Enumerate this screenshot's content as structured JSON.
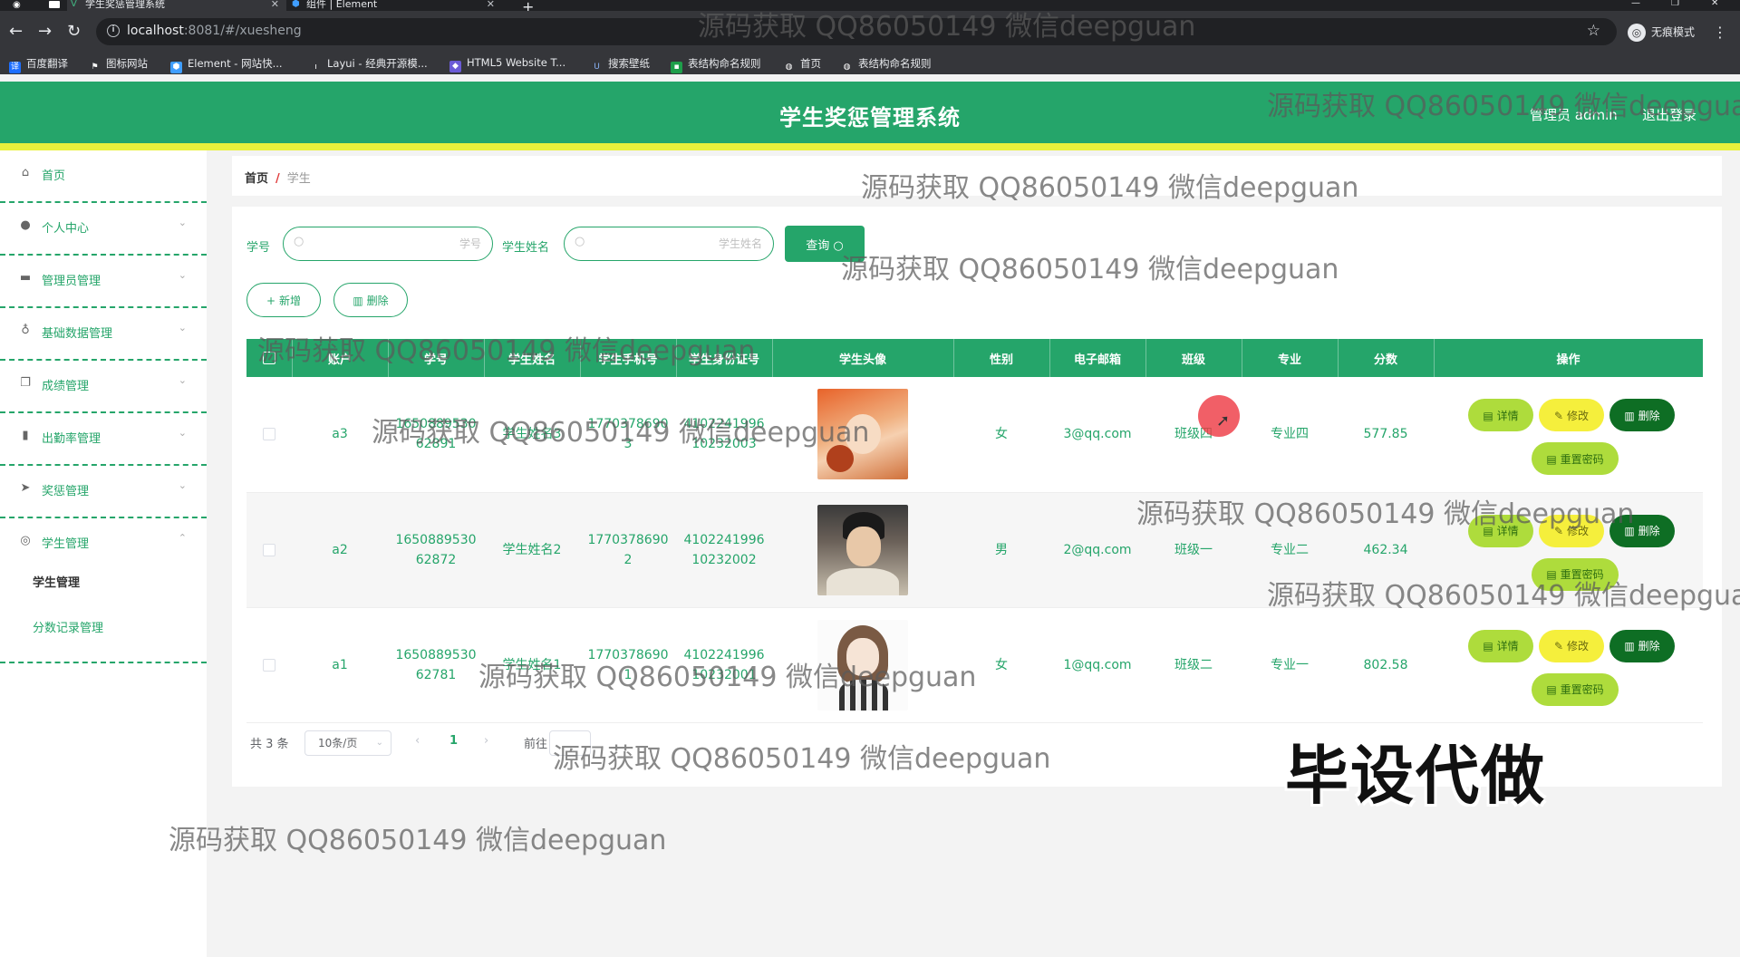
{
  "browser": {
    "tabs": [
      {
        "title": "学生奖惩管理系统",
        "active": true
      },
      {
        "title": "组件 | Element",
        "active": false
      }
    ],
    "url_host": "localhost",
    "url_rest": ":8081/#/xuesheng",
    "incognito_label": "无痕模式",
    "bookmarks": [
      "百度翻译",
      "图标网站",
      "Element - 网站快...",
      "Layui - 经典开源模...",
      "HTML5 Website T...",
      "搜索壁纸",
      "表结构命名规则",
      "首页",
      "表结构命名规则"
    ]
  },
  "header": {
    "title": "学生奖惩管理系统",
    "user": "管理员 admin",
    "logout": "退出登录",
    "colors": {
      "primary": "#25a56a",
      "stripe": "#eaf03c"
    }
  },
  "sidebar": {
    "items": [
      {
        "label": "首页",
        "icon": "home-icon"
      },
      {
        "label": "个人中心",
        "icon": "user-icon"
      },
      {
        "label": "管理员管理",
        "icon": "chat-icon"
      },
      {
        "label": "基础数据管理",
        "icon": "mic-icon"
      },
      {
        "label": "成绩管理",
        "icon": "copy-icon"
      },
      {
        "label": "出勤率管理",
        "icon": "bar-chart-icon"
      },
      {
        "label": "奖惩管理",
        "icon": "send-icon"
      },
      {
        "label": "学生管理",
        "icon": "compass-icon"
      }
    ],
    "sub_items": [
      {
        "label": "学生管理",
        "active": true
      },
      {
        "label": "分数记录管理",
        "active": false
      }
    ]
  },
  "breadcrumb": {
    "home": "首页",
    "separator": "/",
    "current": "学生"
  },
  "search": {
    "student_no_label": "学号",
    "student_no_placeholder": "学号",
    "student_name_label": "学生姓名",
    "student_name_placeholder": "学生姓名",
    "query_button": "查询"
  },
  "actions": {
    "add": "新增",
    "delete": "删除"
  },
  "table": {
    "columns": [
      "账户",
      "学号",
      "学生姓名",
      "学生手机号",
      "学生身份证号",
      "学生头像",
      "性别",
      "电子邮箱",
      "班级",
      "专业",
      "分数",
      "操作"
    ],
    "rows": [
      {
        "account": "a3",
        "student_no": "165088953062891",
        "student_no_l1": "1650889530",
        "student_no_l2": "62891",
        "name": "学生姓名3",
        "phone_l1": "1770378690",
        "phone_l2": "3",
        "id_l1": "4102241996",
        "id_l2": "10232003",
        "gender": "女",
        "email": "3@qq.com",
        "class": "班级四",
        "major": "专业四",
        "score": "577.85"
      },
      {
        "account": "a2",
        "student_no": "165088953062872",
        "student_no_l1": "1650889530",
        "student_no_l2": "62872",
        "name": "学生姓名2",
        "phone_l1": "1770378690",
        "phone_l2": "2",
        "id_l1": "4102241996",
        "id_l2": "10232002",
        "gender": "男",
        "email": "2@qq.com",
        "class": "班级一",
        "major": "专业二",
        "score": "462.34"
      },
      {
        "account": "a1",
        "student_no": "165088953062781",
        "student_no_l1": "1650889530",
        "student_no_l2": "62781",
        "name": "学生姓名1",
        "phone_l1": "1770378690",
        "phone_l2": "1",
        "id_l1": "4102241996",
        "id_l2": "10232001",
        "gender": "女",
        "email": "1@qq.com",
        "class": "班级二",
        "major": "专业一",
        "score": "802.58"
      }
    ],
    "op_labels": {
      "detail": "详情",
      "edit": "修改",
      "delete": "删除",
      "reset": "重置密码"
    }
  },
  "pagination": {
    "total": "共 3 条",
    "page_size": "10条/页",
    "current_page": "1",
    "goto": "前往"
  },
  "overlay": {
    "watermark": "源码获取 QQ86050149 微信deepguan",
    "promo": "毕设代做"
  }
}
